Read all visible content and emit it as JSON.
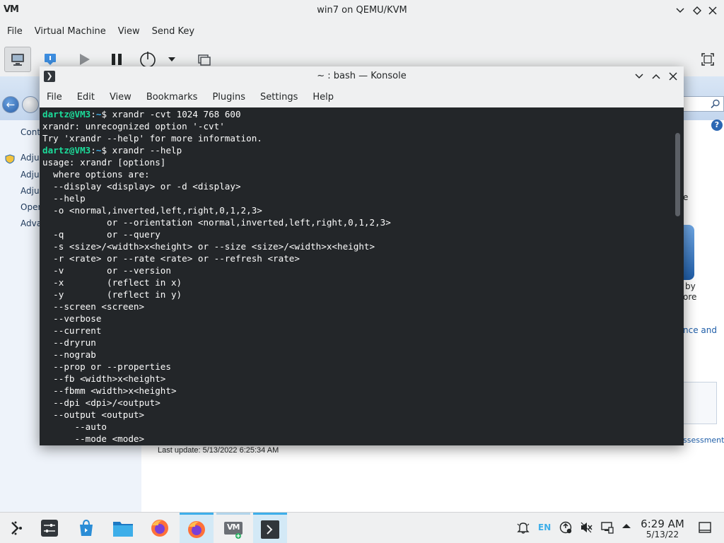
{
  "vm_window": {
    "title": "win7 on QEMU/KVM",
    "app_icon_text": "VM",
    "menu": [
      "File",
      "Virtual Machine",
      "View",
      "Send Key"
    ]
  },
  "guest": {
    "left_items": [
      "Cont",
      "Adju",
      "Adjus",
      "Adjus",
      "Oper",
      "Adva"
    ],
    "fragments": [
      "e",
      "by",
      "ore",
      "nce and",
      "ssessment"
    ],
    "last_update": "Last update: 5/13/2022 6:25:34 AM"
  },
  "konsole": {
    "title": "~ : bash — Konsole",
    "menu": [
      "File",
      "Edit",
      "View",
      "Bookmarks",
      "Plugins",
      "Settings",
      "Help"
    ],
    "prompt_user": "dartz@VM3",
    "prompt_sep": ":",
    "prompt_path": "~",
    "prompt_symbol": "$",
    "cmd1": "xrandr -cvt 1024 768 600",
    "cmd2": "xrandr --help",
    "lines": [
      "xrandr: unrecognized option '-cvt'",
      "Try 'xrandr --help' for more information."
    ],
    "help_lines": [
      "usage: xrandr [options]",
      "  where options are:",
      "  --display <display> or -d <display>",
      "  --help",
      "  -o <normal,inverted,left,right,0,1,2,3>",
      "            or --orientation <normal,inverted,left,right,0,1,2,3>",
      "  -q        or --query",
      "  -s <size>/<width>x<height> or --size <size>/<width>x<height>",
      "  -r <rate> or --rate <rate> or --refresh <rate>",
      "  -v        or --version",
      "  -x        (reflect in x)",
      "  -y        (reflect in y)",
      "  --screen <screen>",
      "  --verbose",
      "  --current",
      "  --dryrun",
      "  --nograb",
      "  --prop or --properties",
      "  --fb <width>x<height>",
      "  --fbmm <width>x<height>",
      "  --dpi <dpi>/<output>",
      "  --output <output>",
      "      --auto",
      "      --mode <mode>"
    ]
  },
  "taskbar": {
    "language": "EN",
    "clock_time": "6:29 AM",
    "clock_date": "5/13/22",
    "vm_icon_text": "VM"
  },
  "colors": {
    "terminal_bg": "#232629",
    "prompt_user": "#1cdc9a",
    "prompt_path": "#3daee9",
    "accent": "#3daee9"
  }
}
